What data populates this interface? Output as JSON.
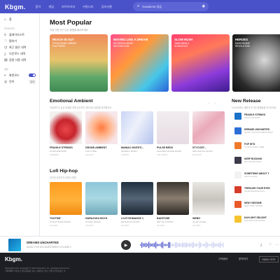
{
  "header": {
    "logo": "Kbgm.",
    "nav": [
      "음악",
      "게임",
      "라이브러리",
      "커뮤니티",
      "공지사항"
    ],
    "search_value": "RAINBOW 일곱"
  },
  "sidebar": {
    "home": "홈",
    "library_section": "라이브러리",
    "library_items": [
      "플레이리스트",
      "찜하기",
      "최근 들은 내역",
      "다운로드 내역",
      "음원 사용 내역"
    ],
    "settings_section": "설정",
    "theme_label": "화면모드",
    "lang_label": "언어",
    "lang_value": "한국"
  },
  "main": {
    "title": "Most Popular",
    "subtitle": "지금 가장 인기 있는 음원을 들어보세요",
    "popular": [
      {
        "title": "REACH IN OUT",
        "artist": "STAGE BAND LIBRARY\nFree PRESS"
      },
      {
        "title": "MOVING LIKE A DREAM",
        "artist": "DE DIGITAL MUSIC\nDAYCHILL1234"
      },
      {
        "title": "SLOW RUSH",
        "artist": "TAME IMPALA\nSOURCE123"
      },
      {
        "title": "HEROES",
        "artist": "DAVID BOWIE\nREVOLUTION"
      }
    ],
    "emotional": {
      "title": "Emotional Ambient",
      "subtitle": "차분해지고 싶은 마음을 위해 감성적인 앰비언트 음원을 준비했어요",
      "cards": [
        {
          "title": "FRAGILE STRINGS",
          "artist": "FLOW AND BOW",
          "extra": "FREEBIE"
        },
        {
          "title": "DRONE-AMBIENT",
          "artist": "LOFI CODE",
          "extra": "saarasol"
        },
        {
          "title": "MANIAC INVESTI...",
          "artist": "MONDAY MUSIC",
          "extra": "JAZZFD"
        },
        {
          "title": "PULSE BEDS",
          "artist": "CHICKEN HOUSE MUSIC",
          "extra": "AIR VIEWS"
        },
        {
          "title": "STYCOST...",
          "artist": "ABC DIGITAL MUSIC",
          "extra": "ENOSNO"
        }
      ]
    },
    "lofi": {
      "title": "Lofi Hip-hop",
      "subtitle": "잔잔한 분위기의 로파이 힙합",
      "cards": [
        {
          "title": "TOOTSIE",
          "artist": "NYGHT WAVE MUSIC",
          "extra": "abc4201"
        },
        {
          "title": "HARAJUKU BOYS",
          "artist": "STUDIO MUSIC",
          "extra": "abc4201"
        },
        {
          "title": "LO-FI ROMANCE 1",
          "artist": "DE DIGITAL MUSIC",
          "extra": "abc4201"
        },
        {
          "title": "BADITUDE",
          "artist": "SET OF 3 MUSIC",
          "extra": "abc4201"
        },
        {
          "title": "WEBO",
          "artist": "OLLIE VOGEL",
          "extra": "abc4201"
        }
      ]
    },
    "new_release": {
      "title": "New Release",
      "subtitle": "K-BGM에서 새롭게 추가된 음원들을 만나보세요",
      "items": [
        {
          "title": "FRAGILE STRINGS",
          "artist": "FLOW AND BOW",
          "color": "#1c72c8"
        },
        {
          "title": "DREAMS UNCHARTED",
          "artist": "MUSIC FOR DOCUMENTARIES",
          "color": "#2b6fd6"
        },
        {
          "title": "POP HITS",
          "artist": "STUDIO SONG LABEL",
          "color": "#f07a2c"
        },
        {
          "title": "KEEP ROCKING",
          "artist": "90S GUITAR ROCK",
          "color": "#3b3b4a"
        },
        {
          "title": "SOMETHING ABOUT Y",
          "artist": "SOUL SONGS",
          "color": "#f2f2f2"
        },
        {
          "title": "THROUGH YOUR EYES",
          "artist": "TAME PERSEVA PLUS",
          "color": "#d73c2c"
        },
        {
          "title": "NEW YORZONE",
          "artist": "NEW YORK SOUND",
          "color": "#e95a2a"
        },
        {
          "title": "DAYLIGHT DELIGHT",
          "artist": "AROUND THE WORLD",
          "color": "#f6c22d"
        }
      ]
    }
  },
  "player": {
    "title": "DREAMS UNCHARTED",
    "artist": "MUSIC FOR DOCUMENTARIES VOLUME 3"
  },
  "footer": {
    "logo": "Kbgm.",
    "copyright": "Modustitel.com Copyright © 2022 ModusKor Co. All Rights Reserved.",
    "address": "서울특별시 마포구 월드컵북로 4길, 사용합니 연구 서울 모두콘텐츠 서",
    "links": [
      "고객센터",
      "문의하기"
    ],
    "family": "FAMILY SITE"
  }
}
